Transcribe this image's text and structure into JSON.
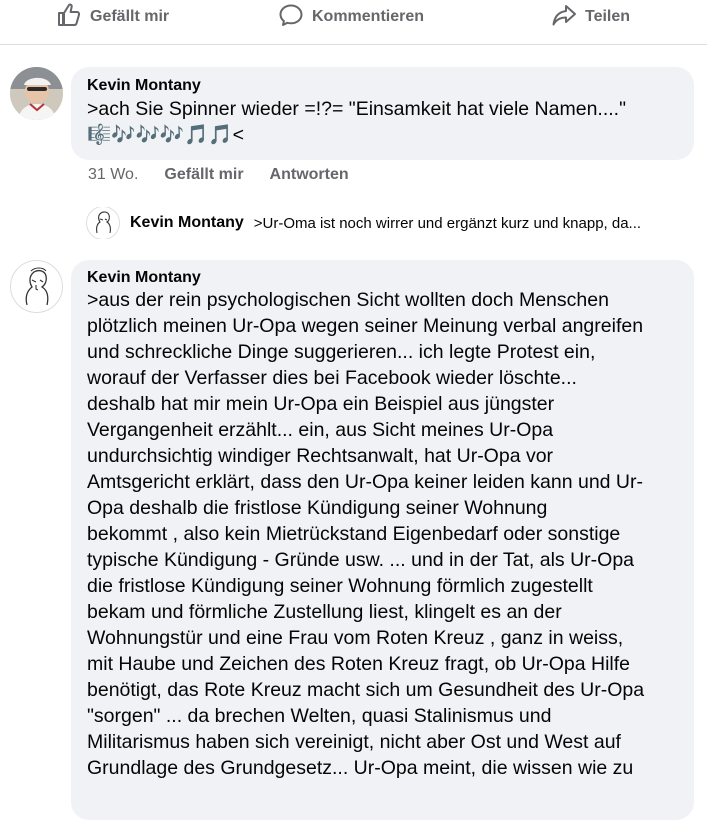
{
  "actions": {
    "like": "Gefällt mir",
    "comment": "Kommentieren",
    "share": "Teilen"
  },
  "comment1": {
    "author": "Kevin Montany",
    "text": ">ach Sie Spinner wieder =!?= \"Einsamkeit hat viele Namen....\"",
    "text_line2": "🎼🎶🎶🎶🎵🎵<",
    "timestamp": "31 Wo.",
    "like_label": "Gefällt mir",
    "reply_label": "Antworten"
  },
  "reply_preview": {
    "author": "Kevin Montany",
    "text": ">Ur-Oma ist noch wirrer und ergänzt kurz und knapp, da..."
  },
  "comment2": {
    "author": "Kevin Montany",
    "lines": [
      ">aus der rein psychologischen Sicht  wollten doch Menschen",
      "plötzlich meinen Ur-Opa wegen seiner Meinung verbal angreifen",
      "und schreckliche Dinge suggerieren... ich legte Protest ein,",
      "worauf der Verfasser dies bei Facebook wieder löschte...",
      "deshalb hat mir mein Ur-Opa ein Beispiel aus jüngster",
      "Vergangenheit erzählt... ein, aus Sicht meines Ur-Opa",
      "undurchsichtig windiger Rechtsanwalt, hat Ur-Opa vor",
      "Amtsgericht erklärt, dass den Ur-Opa keiner leiden kann und Ur-",
      "Opa deshalb die fristlose Kündigung seiner Wohnung",
      "bekommt , also kein Mietrückstand Eigenbedarf oder sonstige",
      "typische Kündigung - Gründe usw. ... und in der Tat, als Ur-Opa",
      "die fristlose Kündigung seiner Wohnung förmlich zugestellt",
      "bekam und förmliche Zustellung liest, klingelt es an der",
      "Wohnungstür und eine Frau vom Roten Kreuz , ganz in weiss,",
      "mit Haube und Zeichen des Roten Kreuz fragt, ob Ur-Opa Hilfe",
      "benötigt, das Rote Kreuz macht sich um Gesundheit des Ur-Opa",
      "\"sorgen\" ... da brechen Welten, quasi Stalinismus und",
      "Militarismus haben sich vereinigt, nicht aber Ost und West auf",
      "Grundlage des Grundgesetz... Ur-Opa meint, die wissen wie zu"
    ]
  },
  "colors": {
    "bubble": "#f0f2f5",
    "meta": "#65676b",
    "divider": "#dadde1"
  },
  "icons": [
    "like-thumb-icon",
    "comment-bubble-icon",
    "share-arrow-icon"
  ]
}
